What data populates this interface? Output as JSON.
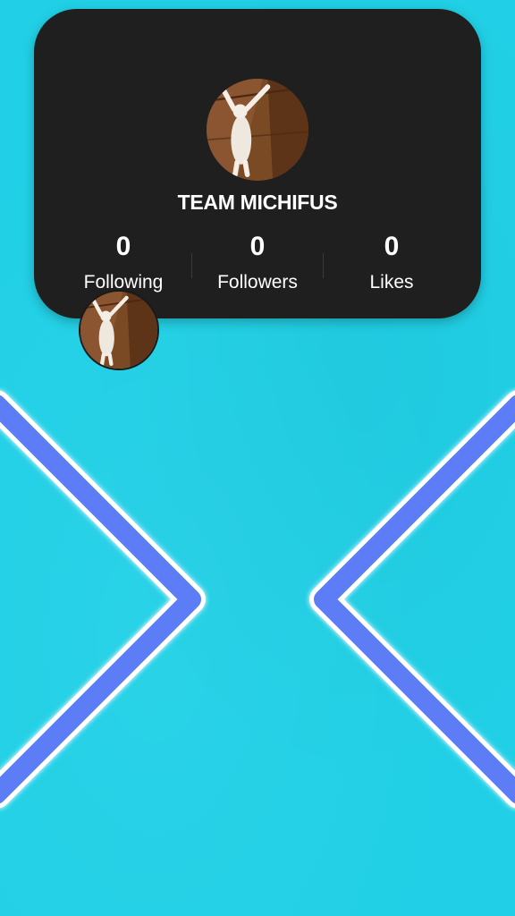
{
  "profile": {
    "team_name": "TEAM MICHIFUS",
    "stats": {
      "following": {
        "value": "0",
        "label": "Following"
      },
      "followers": {
        "value": "0",
        "label": "Followers"
      },
      "likes": {
        "value": "0",
        "label": "Likes"
      }
    }
  },
  "colors": {
    "background": "#21d0e6",
    "card": "#1f1f1f",
    "chevron": "#5b7df5",
    "text": "#ffffff"
  },
  "icons": {
    "left_arrow": "chevron-left-icon",
    "right_arrow": "chevron-right-icon"
  }
}
